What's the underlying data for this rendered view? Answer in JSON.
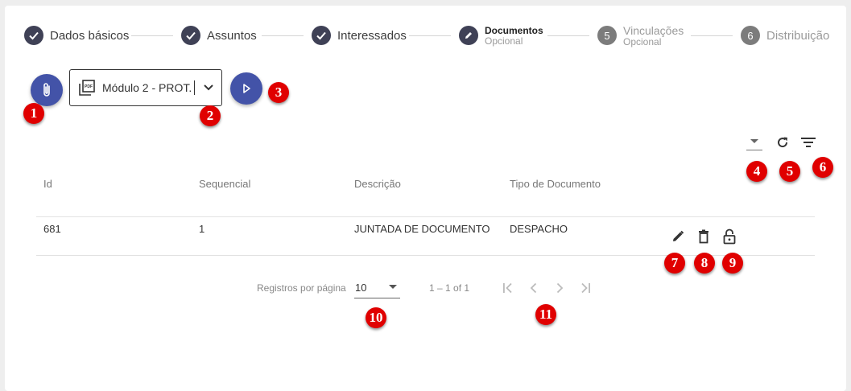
{
  "stepper": {
    "steps": [
      {
        "index": "1",
        "label": "Dados básicos",
        "sub": "",
        "state": "done"
      },
      {
        "index": "2",
        "label": "Assuntos",
        "sub": "",
        "state": "done"
      },
      {
        "index": "3",
        "label": "Interessados",
        "sub": "",
        "state": "done"
      },
      {
        "index": "4",
        "label": "Documentos",
        "sub": "Opcional",
        "state": "edit"
      },
      {
        "index": "5",
        "label": "Vinculações",
        "sub": "Opcional",
        "state": "todo"
      },
      {
        "index": "6",
        "label": "Distribuição",
        "sub": "",
        "state": "todo"
      }
    ]
  },
  "toolbar": {
    "attach_icon": "paperclip-icon",
    "module_select_value": "Módulo 2 - PROT...",
    "module_icon": "pdf-file-icon",
    "play_icon": "play-icon"
  },
  "table_tools": {
    "sort_icon": "dropdown-arrow-icon",
    "refresh_icon": "refresh-icon",
    "filter_icon": "filter-icon"
  },
  "table": {
    "columns": [
      "Id",
      "Sequencial",
      "Descrição",
      "Tipo de Documento"
    ],
    "rows": [
      {
        "id": "681",
        "sequencial": "1",
        "descricao": "JUNTADA DE DOCUMENTO",
        "tipo": "DESPACHO"
      }
    ],
    "row_actions": [
      "edit-icon",
      "delete-icon",
      "unlock-icon"
    ]
  },
  "paginator": {
    "label": "Registros por página",
    "page_size": "10",
    "range": "1 – 1 of 1"
  },
  "annotations": [
    "1",
    "2",
    "3",
    "4",
    "5",
    "6",
    "7",
    "8",
    "9",
    "10",
    "11"
  ],
  "colors": {
    "accent": "#4353a8",
    "step_done": "#3f4156",
    "badge": "#e00000"
  }
}
